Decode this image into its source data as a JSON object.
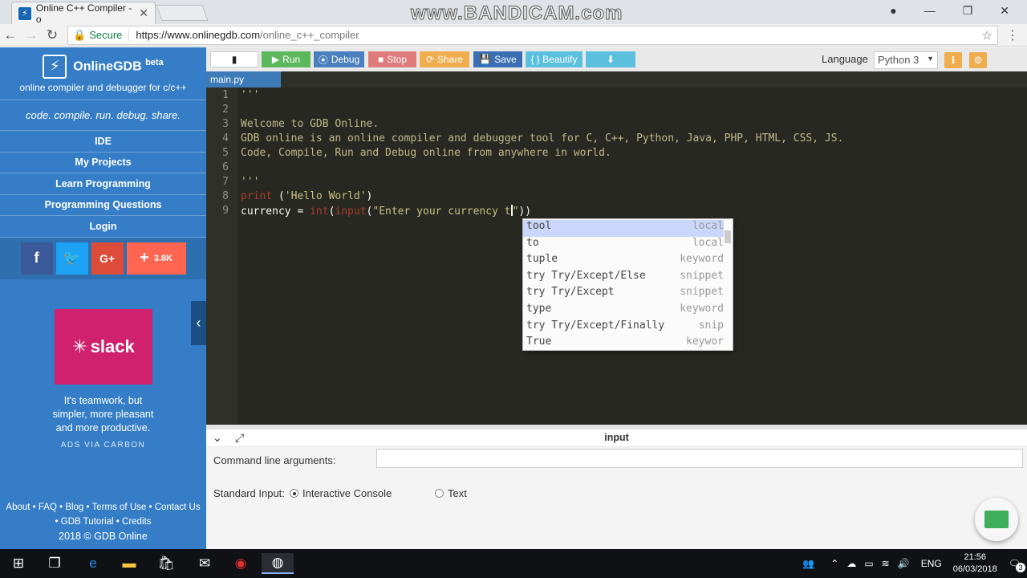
{
  "browser": {
    "tab_title": "Online C++ Compiler - o",
    "tab_close": "✕",
    "watermark": "www.BANDICAM.com",
    "secure_label": "Secure",
    "url_host": "https://www.onlinegdb.com",
    "url_path": "/online_c++_compiler"
  },
  "sidebar": {
    "brand_name": "OnlineGDB",
    "brand_beta": "beta",
    "brand_tagline": "online compiler and debugger for c/c++",
    "motto": "code. compile. run. debug. share.",
    "nav": [
      "IDE",
      "My Projects",
      "Learn Programming",
      "Programming Questions",
      "Login"
    ],
    "social_share_count": "3.8K",
    "ad_brand": "slack",
    "ad_text_1": "It's teamwork, but",
    "ad_text_2": "simpler, more pleasant",
    "ad_text_3": "and more productive.",
    "ads_via": "ADS VIA CARBON",
    "footer_line1": "About • FAQ • Blog • Terms of Use • Contact Us",
    "footer_line2": "• GDB Tutorial • Credits",
    "copyright": "2018 © GDB Online"
  },
  "toolbar": {
    "run": "Run",
    "debug": "Debug",
    "stop": "Stop",
    "share": "Share",
    "save": "Save",
    "beautify": "{ } Beautify",
    "language_label": "Language",
    "language_value": "Python 3"
  },
  "editor": {
    "file_tab": "main.py",
    "line_numbers": [
      "1",
      "2",
      "3",
      "4",
      "5",
      "6",
      "7",
      "8",
      "9"
    ],
    "lines": [
      "'''",
      "",
      "Welcome to GDB Online.",
      "GDB online is an online compiler and debugger tool for C, C++, Python, Java, PHP, HTML, CSS, JS.",
      "Code, Compile, Run and Debug online from anywhere in world.",
      "",
      "'''",
      "print ('Hello World')",
      "currency = int(input(\"Enter your currency t\"))"
    ]
  },
  "autocomplete": {
    "items": [
      {
        "label": "tool",
        "meta": "local"
      },
      {
        "label": "to",
        "meta": "local"
      },
      {
        "label": "tuple",
        "meta": "keyword"
      },
      {
        "label": "try Try/Except/Else",
        "meta": "snippet"
      },
      {
        "label": "try Try/Except",
        "meta": "snippet"
      },
      {
        "label": "type",
        "meta": "keyword"
      },
      {
        "label": "try Try/Except/Finally",
        "meta": "snip"
      },
      {
        "label": "True",
        "meta": "keywor"
      }
    ]
  },
  "io": {
    "panel_title": "input",
    "cmd_label": "Command line arguments:",
    "stdin_label": "Standard Input:",
    "option_interactive": "Interactive Console",
    "option_text": "Text"
  },
  "taskbar": {
    "lang": "ENG",
    "time": "21:56",
    "date": "06/03/2018",
    "notif_count": "3"
  }
}
